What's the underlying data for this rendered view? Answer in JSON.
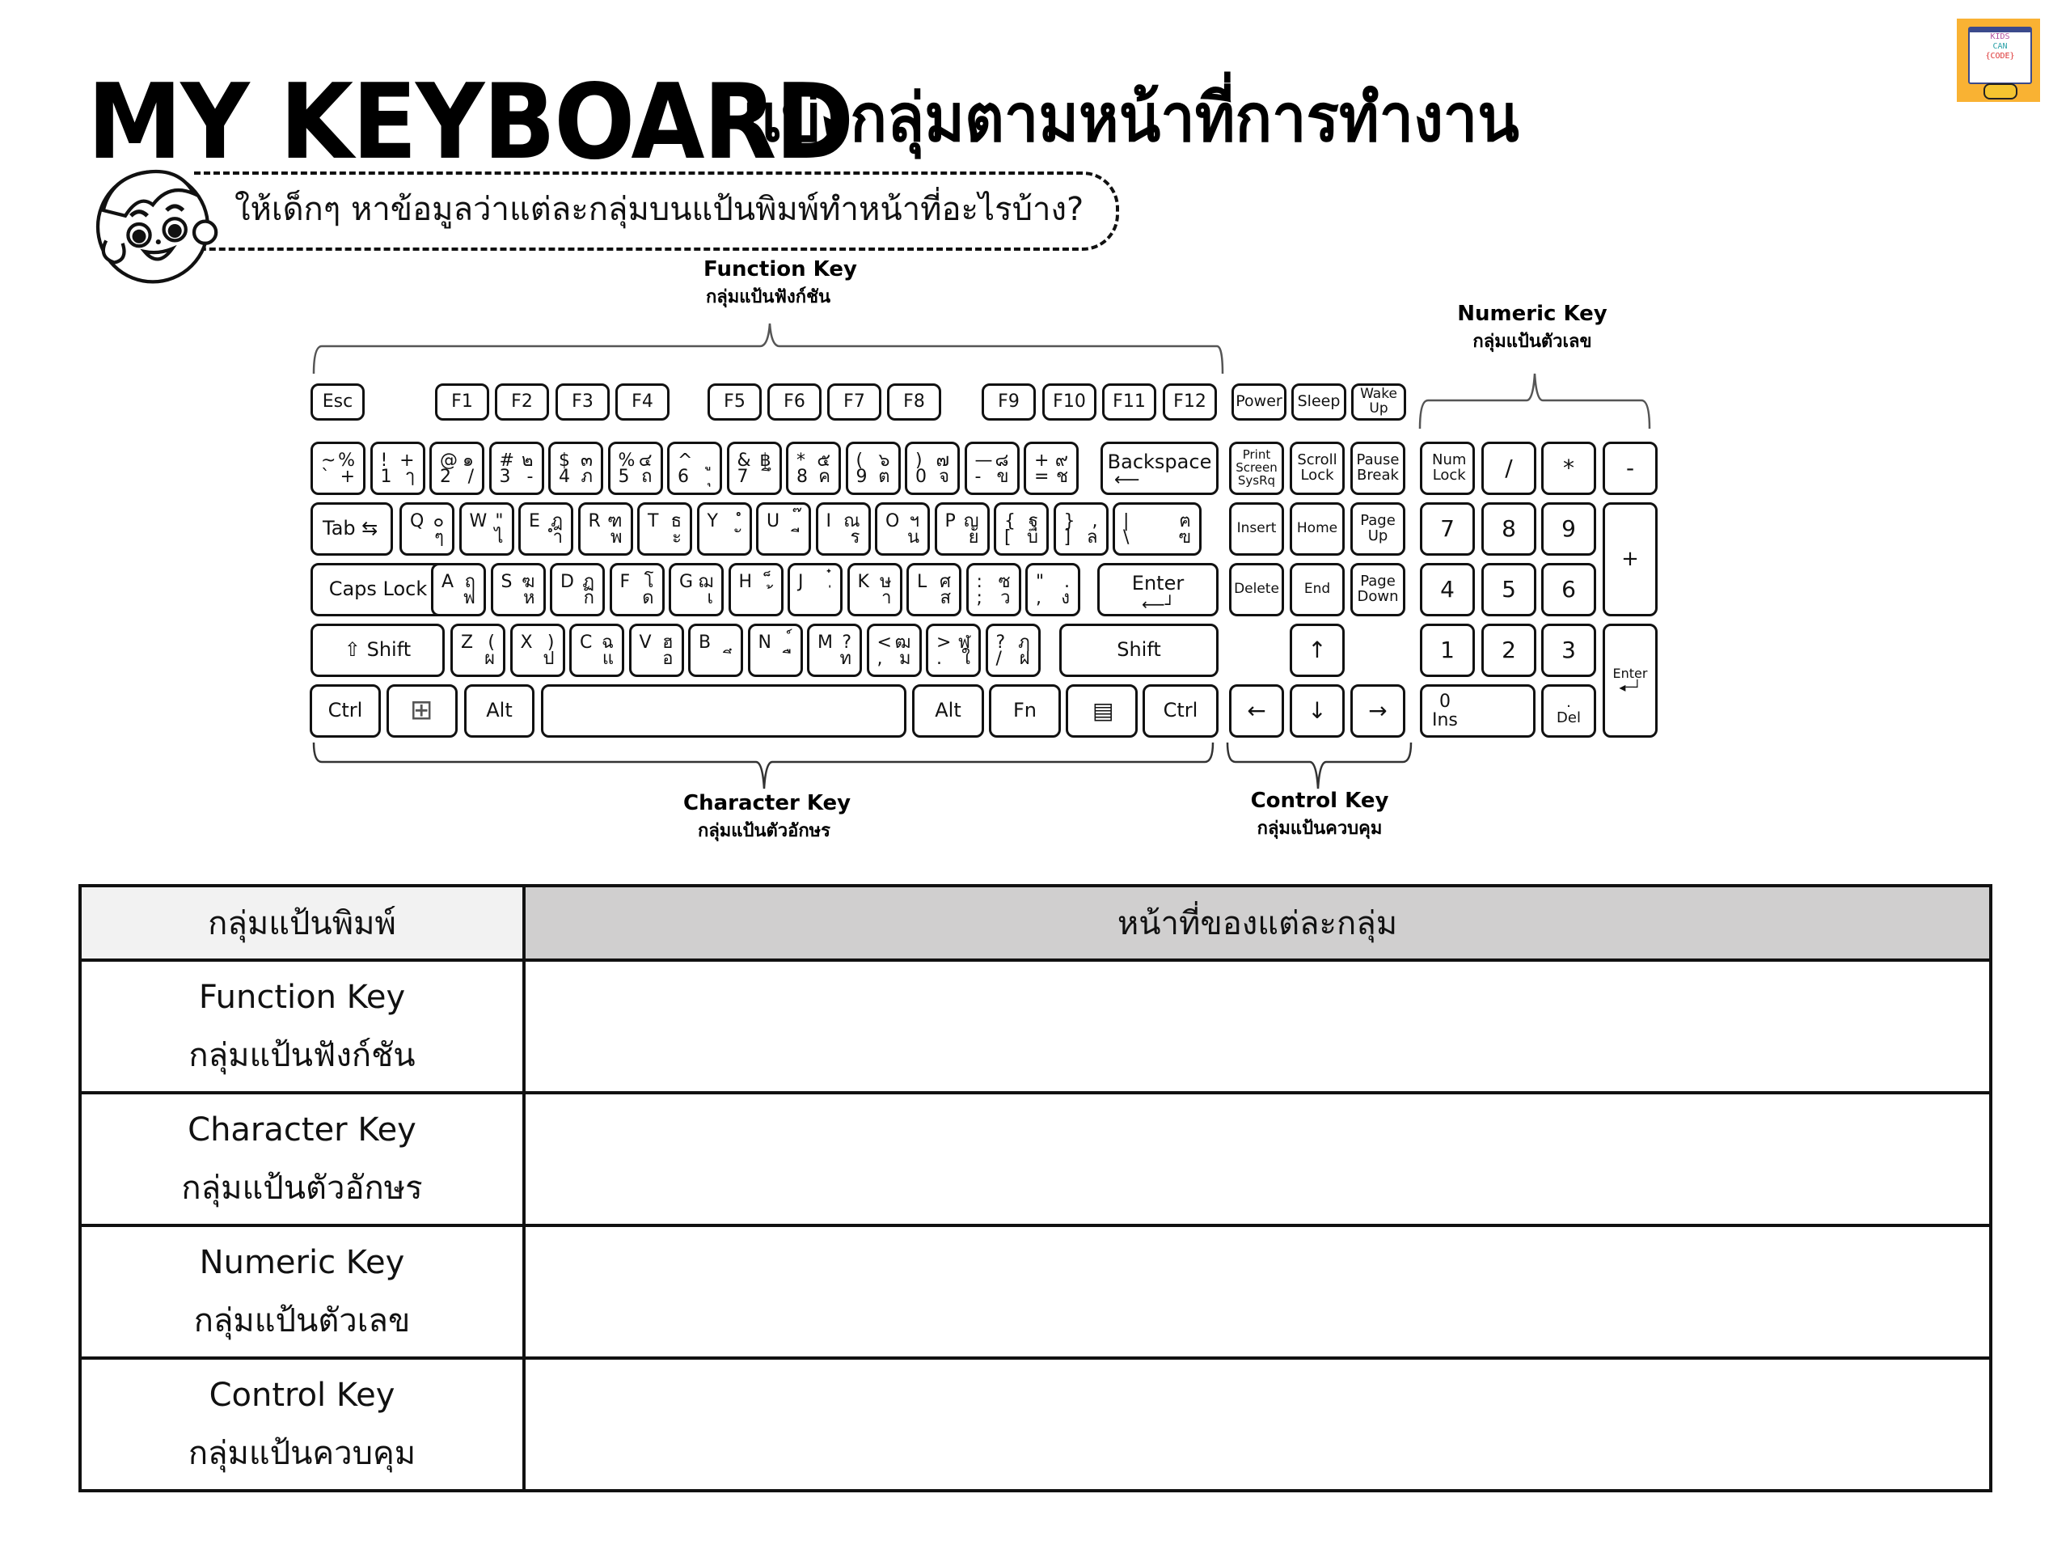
{
  "header": {
    "title_en": "MY KEYBOARD",
    "title_th": "แบ่งกลุ่มตามหน้าที่การทำงาน",
    "instruction": "ให้เด็กๆ หาข้อมูลว่าแต่ละกลุ่มบนแป้นพิมพ์ทำหน้าที่อะไรบ้าง?",
    "logo": {
      "line1": "KIDS",
      "line2": "CAN",
      "line3": "{CODE}",
      "icon": "gamepad-icon"
    }
  },
  "groups": {
    "function": {
      "en": "Function Key",
      "th": "กลุ่มแป้นฟังก์ชัน"
    },
    "numeric": {
      "en": "Numeric Key",
      "th": "กลุ่มแป้นตัวเลข"
    },
    "character": {
      "en": "Character Key",
      "th": "กลุ่มแป้นตัวอักษร"
    },
    "control": {
      "en": "Control Key",
      "th": "กลุ่มแป้นควบคุม"
    }
  },
  "keyboard": {
    "function_row": [
      "Esc",
      "F1",
      "F2",
      "F3",
      "F4",
      "F5",
      "F6",
      "F7",
      "F8",
      "F9",
      "F10",
      "F11",
      "F12"
    ],
    "system_keys": [
      "Power",
      "Sleep",
      "Wake\nUp"
    ],
    "number_row": [
      {
        "tl": "~",
        "tr": "%",
        "bl": "`",
        "br": "+"
      },
      {
        "tl": "!",
        "tr": "+",
        "bl": "1",
        "br": "ๅ"
      },
      {
        "tl": "@",
        "tr": "๑",
        "bl": "2",
        "br": "/"
      },
      {
        "tl": "#",
        "tr": "๒",
        "bl": "3",
        "br": "-"
      },
      {
        "tl": "$",
        "tr": "๓",
        "bl": "4",
        "br": "ภ"
      },
      {
        "tl": "%",
        "tr": "๔",
        "bl": "5",
        "br": "ถ"
      },
      {
        "tl": "^",
        "tr": "ู",
        "bl": "6",
        "br": "ุ"
      },
      {
        "tl": "&",
        "tr": "฿",
        "bl": "7",
        "br": "ึ"
      },
      {
        "tl": "*",
        "tr": "๕",
        "bl": "8",
        "br": "ค"
      },
      {
        "tl": "(",
        "tr": "๖",
        "bl": "9",
        "br": "ต"
      },
      {
        "tl": ")",
        "tr": "๗",
        "bl": "0",
        "br": "จ"
      },
      {
        "tl": "—",
        "tr": "๘",
        "bl": "-",
        "br": "ข"
      },
      {
        "tl": "+",
        "tr": "๙",
        "bl": "=",
        "br": "ช"
      }
    ],
    "backspace": "Backspace",
    "tab": "Tab",
    "qwerty_row": [
      {
        "tl": "Q",
        "tr": "๐",
        "br": "ๆ"
      },
      {
        "tl": "W",
        "tr": "\"",
        "br": "ไ"
      },
      {
        "tl": "E",
        "tr": "ฎ",
        "br": "ำ"
      },
      {
        "tl": "R",
        "tr": "ฑ",
        "br": "พ"
      },
      {
        "tl": "T",
        "tr": "ธ",
        "br": "ะ"
      },
      {
        "tl": "Y",
        "tr": "ํ",
        "br": "ั"
      },
      {
        "tl": "U",
        "tr": "๊",
        "br": "ี"
      },
      {
        "tl": "I",
        "tr": "ณ",
        "br": "ร"
      },
      {
        "tl": "O",
        "tr": "ฯ",
        "br": "น"
      },
      {
        "tl": "P",
        "tr": "ญ",
        "br": "ย"
      },
      {
        "tl": "{",
        "tr": "ฐ",
        "bl": "[",
        "br": "บ"
      },
      {
        "tl": "}",
        "tr": ",",
        "bl": "]",
        "br": "ล"
      },
      {
        "tl": "|",
        "tr": "ฅ",
        "bl": "\\",
        "br": "ฃ"
      }
    ],
    "caps_lock": "Caps Lock",
    "home_row": [
      {
        "tl": "A",
        "tr": "ฤ",
        "br": "ฟ"
      },
      {
        "tl": "S",
        "tr": "ฆ",
        "br": "ห"
      },
      {
        "tl": "D",
        "tr": "ฏ",
        "br": "ก"
      },
      {
        "tl": "F",
        "tr": "โ",
        "br": "ด"
      },
      {
        "tl": "G",
        "tr": "ฌ",
        "br": "เ"
      },
      {
        "tl": "H",
        "tr": "็",
        "br": "้"
      },
      {
        "tl": "J",
        "tr": "๋",
        "br": "่"
      },
      {
        "tl": "K",
        "tr": "ษ",
        "br": "า"
      },
      {
        "tl": "L",
        "tr": "ศ",
        "br": "ส"
      },
      {
        "tl": ":",
        "tr": "ซ",
        "bl": ";",
        "br": "ว"
      },
      {
        "tl": "\"",
        "tr": ".",
        "bl": ",",
        "br": "ง"
      }
    ],
    "enter": "Enter",
    "shift": "Shift",
    "bottom_letter_row": [
      {
        "tl": "Z",
        "tr": "(",
        "br": "ผ"
      },
      {
        "tl": "X",
        "tr": ")",
        "br": "ป"
      },
      {
        "tl": "C",
        "tr": "ฉ",
        "br": "แ"
      },
      {
        "tl": "V",
        "tr": "ฮ",
        "br": "อ"
      },
      {
        "tl": "B",
        "tr": "ฺ",
        "br": "ิ"
      },
      {
        "tl": "N",
        "tr": "์",
        "br": "ื"
      },
      {
        "tl": "M",
        "tr": "?",
        "br": "ท"
      },
      {
        "tl": "<",
        "tr": "ฒ",
        "bl": ",",
        "br": "ม"
      },
      {
        "tl": ">",
        "tr": "ฬ",
        "bl": ".",
        "br": "ใ"
      },
      {
        "tl": "?",
        "tr": "ฦ",
        "bl": "/",
        "br": "ฝ"
      }
    ],
    "ctrl": "Ctrl",
    "alt": "Alt",
    "fn": "Fn",
    "nav_keys": [
      "Print\nScreen\nSysRq",
      "Scroll\nLock",
      "Pause\nBreak",
      "Insert",
      "Home",
      "Page\nUp",
      "Delete",
      "End",
      "Page\nDown"
    ],
    "arrows": {
      "up": "↑",
      "left": "←",
      "down": "↓",
      "right": "→"
    },
    "numpad": {
      "row1": [
        "Num\nLock",
        "/",
        "*",
        "-"
      ],
      "row2": [
        "7",
        "8",
        "9"
      ],
      "plus": "+",
      "row3": [
        "4",
        "5",
        "6"
      ],
      "row4": [
        "1",
        "2",
        "3"
      ],
      "enter": "Enter",
      "zero": "0\nIns",
      "dot": ".\nDel"
    }
  },
  "table": {
    "headers": [
      "กลุ่มแป้นพิมพ์",
      "หน้าที่ของแต่ละกลุ่ม"
    ],
    "rows": [
      {
        "en": "Function Key",
        "th": "กลุ่มแป้นฟังก์ชัน",
        "answer": ""
      },
      {
        "en": "Character Key",
        "th": "กลุ่มแป้นตัวอักษร",
        "answer": ""
      },
      {
        "en": "Numeric Key",
        "th": "กลุ่มแป้นตัวเลข",
        "answer": ""
      },
      {
        "en": "Control Key",
        "th": "กลุ่มแป้นควบคุม",
        "answer": ""
      }
    ]
  }
}
